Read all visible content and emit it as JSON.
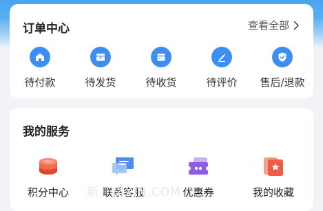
{
  "orders": {
    "title": "订单中心",
    "view_all": "查看全部",
    "items": [
      {
        "label": "待付款",
        "icon": "home-icon"
      },
      {
        "label": "待发货",
        "icon": "package-icon"
      },
      {
        "label": "待收货",
        "icon": "delivery-box-icon"
      },
      {
        "label": "待评价",
        "icon": "pen-icon"
      },
      {
        "label": "售后/退款",
        "icon": "shield-check-icon"
      }
    ]
  },
  "services": {
    "title": "我的服务",
    "items": [
      {
        "label": "积分中心",
        "icon": "coins-stack-icon"
      },
      {
        "label": "联系客服",
        "icon": "chat-bubbles-icon"
      },
      {
        "label": "优惠券",
        "icon": "coupon-icon"
      },
      {
        "label": "我的收藏",
        "icon": "favorite-star-icon"
      }
    ]
  },
  "watermark": "新 · SJXIN.COM",
  "colors": {
    "accent": "#3d8ef3",
    "header_blue": "#4aa5ef",
    "coins": "#ef5b3f",
    "chat": "#4d8cf0",
    "coupon": "#8f5ce6",
    "favorite": "#ef6a5a"
  }
}
